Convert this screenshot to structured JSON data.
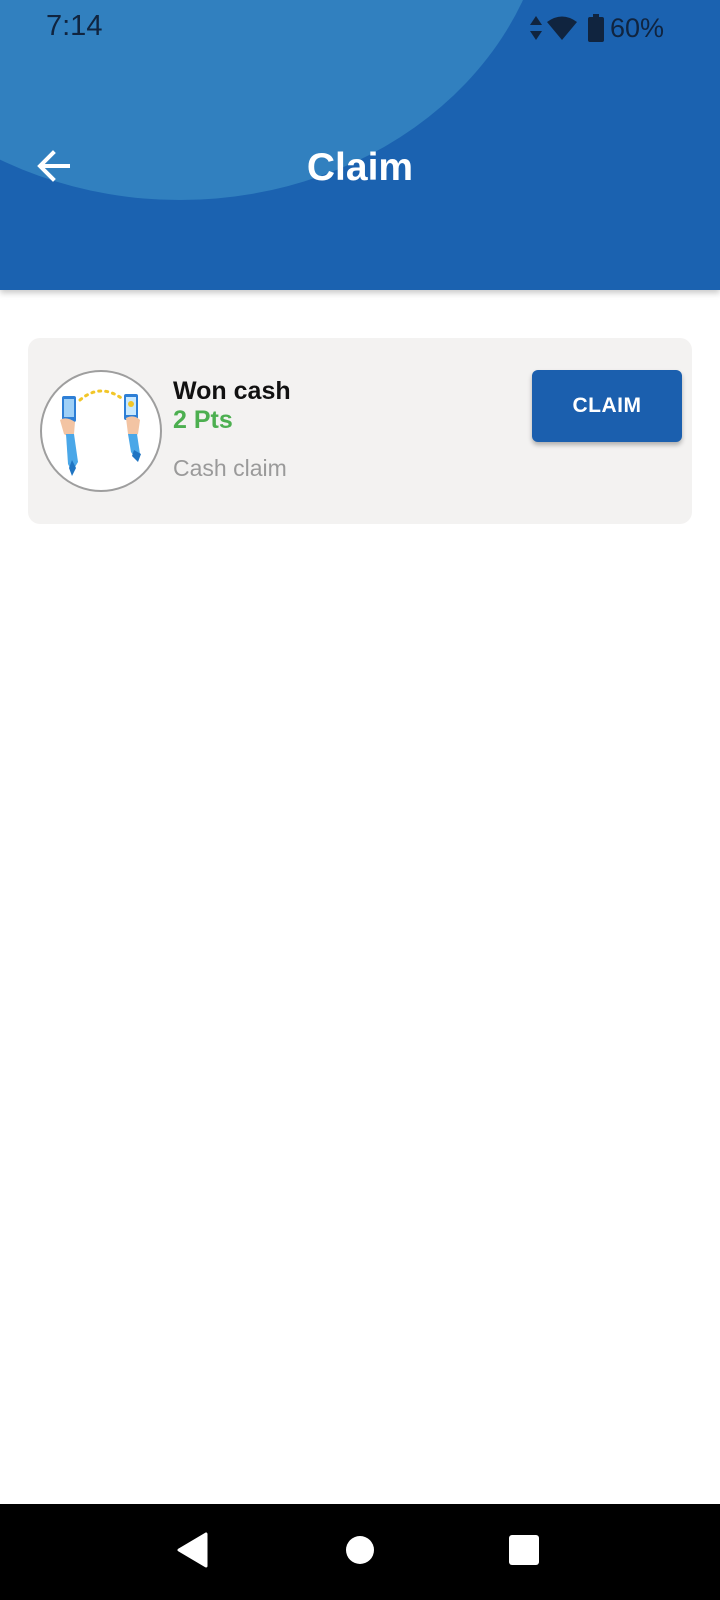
{
  "status_bar": {
    "time": "7:14",
    "battery": "60%",
    "icons": [
      "data-arrows-icon",
      "wifi-icon",
      "battery-icon"
    ]
  },
  "toolbar": {
    "title": "Claim",
    "back_icon": "arrow-left-icon"
  },
  "claim_item": {
    "title": "Won cash",
    "points": "2 Pts",
    "subtitle": "Cash claim",
    "button_label": "CLAIM",
    "image": "cash-transfer-illustration"
  },
  "nav_bar": {
    "buttons": [
      "back-triangle-icon",
      "home-circle-icon",
      "recents-square-icon"
    ]
  },
  "colors": {
    "header": "#1b62b0",
    "header_accent": "#3180bf",
    "button": "#1b5fae",
    "points": "#4caf50",
    "card": "#f3f2f1",
    "subtitle": "#9a9a9a"
  }
}
